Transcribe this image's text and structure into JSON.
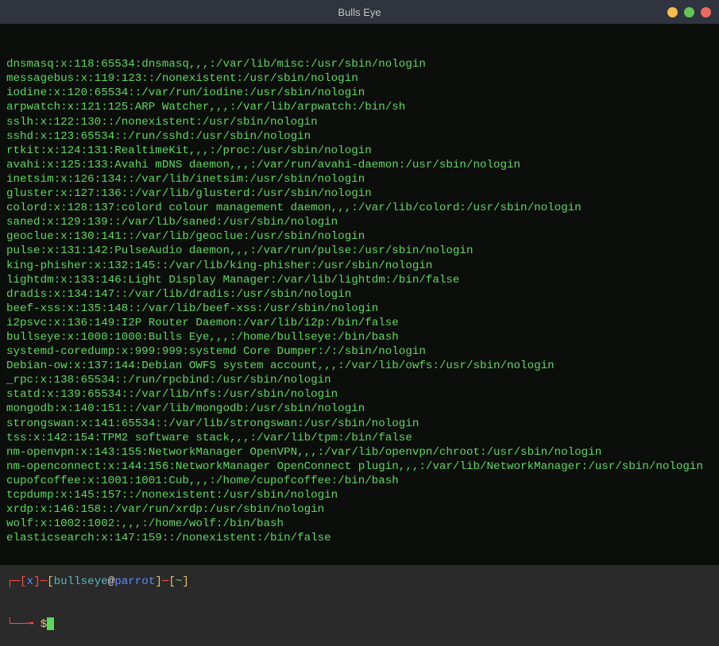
{
  "window": {
    "title": "Bulls Eye"
  },
  "output": [
    "dnsmasq:x:118:65534:dnsmasq,,,:/var/lib/misc:/usr/sbin/nologin",
    "messagebus:x:119:123::/nonexistent:/usr/sbin/nologin",
    "iodine:x:120:65534::/var/run/iodine:/usr/sbin/nologin",
    "arpwatch:x:121:125:ARP Watcher,,,:/var/lib/arpwatch:/bin/sh",
    "sslh:x:122:130::/nonexistent:/usr/sbin/nologin",
    "sshd:x:123:65534::/run/sshd:/usr/sbin/nologin",
    "rtkit:x:124:131:RealtimeKit,,,:/proc:/usr/sbin/nologin",
    "avahi:x:125:133:Avahi mDNS daemon,,,:/var/run/avahi-daemon:/usr/sbin/nologin",
    "inetsim:x:126:134::/var/lib/inetsim:/usr/sbin/nologin",
    "gluster:x:127:136::/var/lib/glusterd:/usr/sbin/nologin",
    "colord:x:128:137:colord colour management daemon,,,:/var/lib/colord:/usr/sbin/nologin",
    "saned:x:129:139::/var/lib/saned:/usr/sbin/nologin",
    "geoclue:x:130:141::/var/lib/geoclue:/usr/sbin/nologin",
    "pulse:x:131:142:PulseAudio daemon,,,:/var/run/pulse:/usr/sbin/nologin",
    "king-phisher:x:132:145::/var/lib/king-phisher:/usr/sbin/nologin",
    "lightdm:x:133:146:Light Display Manager:/var/lib/lightdm:/bin/false",
    "dradis:x:134:147::/var/lib/dradis:/usr/sbin/nologin",
    "beef-xss:x:135:148::/var/lib/beef-xss:/usr/sbin/nologin",
    "i2psvc:x:136:149:I2P Router Daemon:/var/lib/i2p:/bin/false",
    "bullseye:x:1000:1000:Bulls Eye,,,:/home/bullseye:/bin/bash",
    "systemd-coredump:x:999:999:systemd Core Dumper:/:/sbin/nologin",
    "Debian-ow:x:137:144:Debian OWFS system account,,,:/var/lib/owfs:/usr/sbin/nologin",
    "_rpc:x:138:65534::/run/rpcbind:/usr/sbin/nologin",
    "statd:x:139:65534::/var/lib/nfs:/usr/sbin/nologin",
    "mongodb:x:140:151::/var/lib/mongodb:/usr/sbin/nologin",
    "strongswan:x:141:65534::/var/lib/strongswan:/usr/sbin/nologin",
    "tss:x:142:154:TPM2 software stack,,,:/var/lib/tpm:/bin/false",
    "nm-openvpn:x:143:155:NetworkManager OpenVPN,,,:/var/lib/openvpn/chroot:/usr/sbin/nologin",
    "nm-openconnect:x:144:156:NetworkManager OpenConnect plugin,,,:/var/lib/NetworkManager:/usr/sbin/nologin",
    "cupofcoffee:x:1001:1001:Cub,,,:/home/cupofcoffee:/bin/bash",
    "tcpdump:x:145:157::/nonexistent:/usr/sbin/nologin",
    "xrdp:x:146:158::/var/run/xrdp:/usr/sbin/nologin",
    "wolf:x:1002:1002:,,,:/home/wolf:/bin/bash",
    "elasticsearch:x:147:159::/nonexistent:/bin/false"
  ],
  "prompt": {
    "corner_tl": "┌─",
    "bracket_l": "[",
    "x": "x",
    "bracket_r": "]",
    "dash": "─",
    "user": "bullseye",
    "at": "@",
    "host": "parrot",
    "path": "~",
    "corner_bl": "└──╼",
    "dollar": " $"
  }
}
